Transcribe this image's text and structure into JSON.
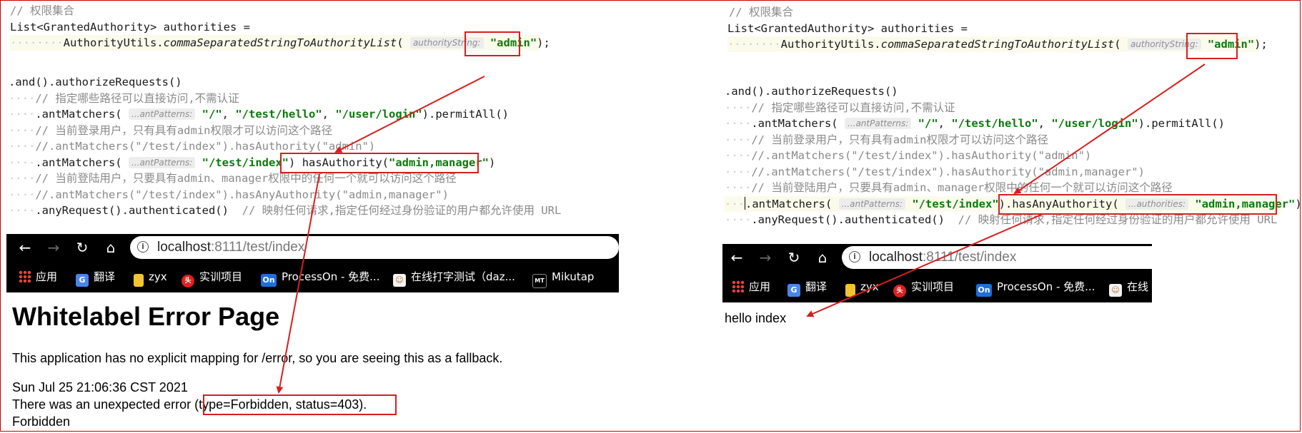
{
  "left": {
    "code": {
      "comment_perms": "// 权限集合",
      "list_decl": "List<GrantedAuthority> authorities =",
      "authutils_class": "AuthorityUtils.",
      "authutils_method": "commaSeparatedStringToAuthorityList",
      "open_paren": "(",
      "param_hint": "authorityString:",
      "admin_str": "\"admin\"",
      "close_semi": ");",
      "and_line": ".and().authorizeRequests()",
      "comment_whitelist": "// 指定哪些路径可以直接访问,不需认证",
      "antmatchers": ".antMatchers(",
      "ant_hint": "...antPatterns:",
      "root_str": "\"/\"",
      "comma": ", ",
      "hello_str": "\"/test/hello\"",
      "login_str": "\"/user/login\"",
      "permit_all": ").permitAll()",
      "comment_admin_only": "// 当前登录用户，只有具有admin权限才可以访问这个路径",
      "commented_hasauth_admin": "//.antMatchers(\"/test/index\").hasAuthority(\"admin\")",
      "index_str": "\"/test/index\"",
      "close_paren": ")",
      "dot": ".",
      "has_authority": "hasAuthority(",
      "admin_manager_str": "\"admin,manager\"",
      "comment_any": "// 当前登陆用户，只要具有admin、manager权限中的任何一个就可以访问这个路径",
      "commented_hasany": "//.antMatchers(\"/test/index\").hasAnyAuthority(\"admin,manager\")",
      "any_request": ".anyRequest().authenticated()",
      "comment_map_any": "// 映射任何请求,指定任何经过身份验证的用户都允许使用 URL"
    },
    "browser": {
      "url_host": "localhost",
      "url_path": ":8111/test/index",
      "bookmarks": [
        {
          "label": "应用",
          "icon": "apps-grid-icon"
        },
        {
          "label": "翻译",
          "icon": "translate-icon"
        },
        {
          "label": "zyx",
          "icon": "folder-icon"
        },
        {
          "label": "实训项目",
          "icon": "toutiao-icon"
        },
        {
          "label": "ProcessOn - 免费...",
          "icon": "processon-icon"
        },
        {
          "label": "在线打字测试（daz...",
          "icon": "dazi-icon"
        },
        {
          "label": "Mikutap",
          "icon": "mikutap-icon"
        }
      ]
    },
    "error_page": {
      "title": "Whitelabel Error Page",
      "message": "This application has no explicit mapping for /error, so you are seeing this as a fallback.",
      "timestamp": "Sun Jul 25 21:06:36 CST 2021",
      "unexpected": "There was an unexpected error ",
      "type_status": "(type=Forbidden, status=403).",
      "forbidden": "Forbidden"
    }
  },
  "right": {
    "code": {
      "comment_perms": "// 权限集合",
      "list_decl": "List<GrantedAuthority> authorities =",
      "authutils_class": "AuthorityUtils.",
      "authutils_method": "commaSeparatedStringToAuthorityList",
      "open_paren": "(",
      "param_hint": "authorityString:",
      "admin_str": "\"admin\"",
      "close_semi": ");",
      "and_line": ".and().authorizeRequests()",
      "comment_whitelist": "// 指定哪些路径可以直接访问,不需认证",
      "antmatchers": ".antMatchers(",
      "ant_hint": "...antPatterns:",
      "root_str": "\"/\"",
      "comma": ", ",
      "hello_str": "\"/test/hello\"",
      "login_str": "\"/user/login\"",
      "permit_all": ").permitAll()",
      "comment_admin_only": "// 当前登录用户，只有具有admin权限才可以访问这个路径",
      "commented_hasauth_admin": "//.antMatchers(\"/test/index\").hasAuthority(\"admin\")",
      "commented_hasauth_am": "//.antMatchers(\"/test/index\").hasAuthority(\"admin,manager\")",
      "comment_any": "// 当前登陆用户，只要具有admin、manager权限中的任何一个就可以访问这个路径",
      "index_str": "\"/test/index\"",
      "close_dot": ").",
      "has_any": "hasAnyAuthority(",
      "auth_hint": "...authorities:",
      "admin_manager_str": "\"admin,manager\"",
      "close_paren": ")",
      "any_request": ".anyRequest().authenticated()",
      "comment_map_any": "// 映射任何请求,指定任何经过身份验证的用户都允许使用 URL"
    },
    "browser": {
      "url_host": "localhost",
      "url_path": ":8111/test/index",
      "bookmarks": [
        {
          "label": "应用",
          "icon": "apps-grid-icon"
        },
        {
          "label": "翻译",
          "icon": "translate-icon"
        },
        {
          "label": "zyx",
          "icon": "folder-icon"
        },
        {
          "label": "实训项目",
          "icon": "toutiao-icon"
        },
        {
          "label": "ProcessOn - 免费...",
          "icon": "processon-icon"
        },
        {
          "label": "在线",
          "icon": "dazi-icon"
        }
      ]
    },
    "result_text": "hello index"
  },
  "colors": {
    "annotation_red": "#d81e1e",
    "string_green": "#0b7a0b",
    "comment_gray": "#8a8a8a",
    "browser_bar": "#000000"
  }
}
